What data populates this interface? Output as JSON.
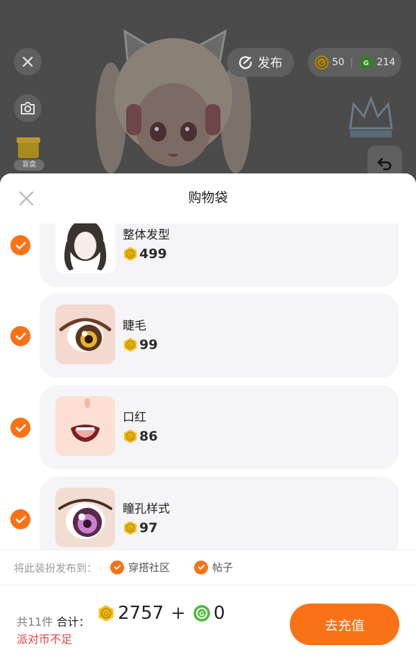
{
  "top_bar": {
    "publish_label": "发布",
    "currency_gold": "50",
    "currency_separator": "|",
    "currency_green": "214",
    "blindbox_label": "盲盒"
  },
  "sheet": {
    "title": "购物袋",
    "items": [
      {
        "name": "整体发型",
        "price": "499",
        "coin": "gold"
      },
      {
        "name": "睫毛",
        "price": "99",
        "coin": "gold"
      },
      {
        "name": "口红",
        "price": "86",
        "coin": "gold"
      },
      {
        "name": "瞳孔样式",
        "price": "97",
        "coin": "gold"
      }
    ],
    "publish_to_label": "将此装扮发布到：",
    "publish_options": [
      "穿搭社区",
      "帖子"
    ]
  },
  "footer": {
    "count_label": "共11件",
    "total_label": "合计：",
    "gold_total": "2757",
    "plus": "+",
    "green_total": "0",
    "warning": "派对币不足",
    "recharge_label": "去充值"
  },
  "colors": {
    "accent": "#f97316",
    "gold_coin": "#f4c21b",
    "green_coin": "#4cb83f",
    "warning": "#ef3b3b"
  },
  "icons": [
    "close-icon",
    "camera-icon",
    "publish-icon",
    "gold-coin-icon",
    "green-coin-icon",
    "undo-icon",
    "check-icon"
  ]
}
